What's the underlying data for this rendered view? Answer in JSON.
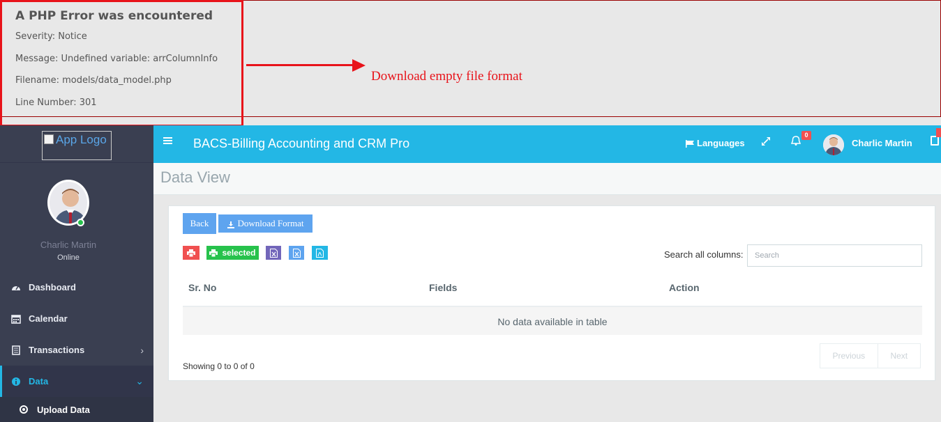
{
  "php_error": {
    "title": "A PHP Error was encountered",
    "severity": "Severity: Notice",
    "message": "Message: Undefined variable: arrColumnInfo",
    "filename": "Filename: models/data_model.php",
    "line_number": "Line Number: 301"
  },
  "annotation": {
    "text": "Download empty file format",
    "color": "#e8131a"
  },
  "sidebar": {
    "logo_alt": "App Logo",
    "user_name": "Charlic Martin",
    "user_status": "Online",
    "items": [
      {
        "label": "Dashboard",
        "icon": "dashboard-icon"
      },
      {
        "label": "Calendar",
        "icon": "calendar-icon"
      },
      {
        "label": "Transactions",
        "icon": "ledger-icon"
      },
      {
        "label": "Data",
        "icon": "info-icon"
      }
    ],
    "sub_item": {
      "label": "Upload Data",
      "icon": "circle-dot-icon"
    }
  },
  "header": {
    "app_title": "BACS-Billing Accounting and CRM Pro",
    "languages_label": "Languages",
    "notification_count": "0",
    "user_name": "Charlic Martin",
    "accent": "#23b7e5"
  },
  "page": {
    "title": "Data View"
  },
  "toolbar": {
    "back_label": "Back",
    "download_label": "Download Format",
    "selected_label": "selected"
  },
  "search": {
    "label": "Search all columns:",
    "placeholder": "Search"
  },
  "table": {
    "columns": [
      "Sr. No",
      "Fields",
      "Action"
    ],
    "empty_message": "No data available in table",
    "showing": "Showing 0 to 0 of 0",
    "prev_label": "Previous",
    "next_label": "Next"
  }
}
